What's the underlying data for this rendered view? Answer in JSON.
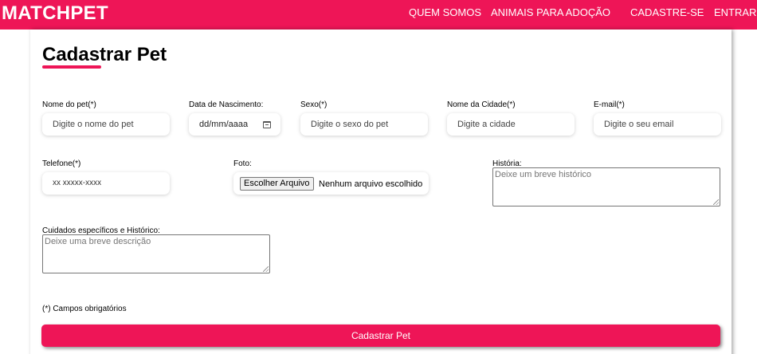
{
  "navbar": {
    "brand": "MATCHPET",
    "links": [
      "QUEM SOMOS",
      "ANIMAIS PARA ADOÇÃO",
      "CADASTRE-SE",
      "ENTRAR"
    ]
  },
  "form": {
    "title": "Cadastrar Pet",
    "fields": {
      "nome": {
        "label": "Nome do pet(*)",
        "placeholder": "Digite o nome do pet"
      },
      "nascimento": {
        "label": "Data de Nascimento:",
        "placeholder": "dd/mm/aaaa"
      },
      "sexo": {
        "label": "Sexo(*)",
        "placeholder": "Digite o sexo do pet"
      },
      "cidade": {
        "label": "Nome da Cidade(*)",
        "placeholder": "Digite a cidade"
      },
      "email": {
        "label": "E-mail(*)",
        "placeholder": "Digite o seu email"
      },
      "telefone": {
        "label": "Telefone(*)",
        "placeholder": "xx xxxxx-xxxx"
      },
      "foto": {
        "label": "Foto:",
        "button_label": "Escolher Arquivo",
        "status": "Nenhum arquivo escolhido"
      },
      "historia": {
        "label": "História:",
        "placeholder": "Deixe um breve histórico"
      },
      "cuidados": {
        "label": "Cuidados específicos e Histórico:",
        "placeholder": "Deixe uma breve descrição"
      }
    },
    "required_note": "(*) Campos obrigatórios",
    "submit_label": "Cadastrar Pet"
  },
  "colors": {
    "accent": "#ee1557"
  }
}
